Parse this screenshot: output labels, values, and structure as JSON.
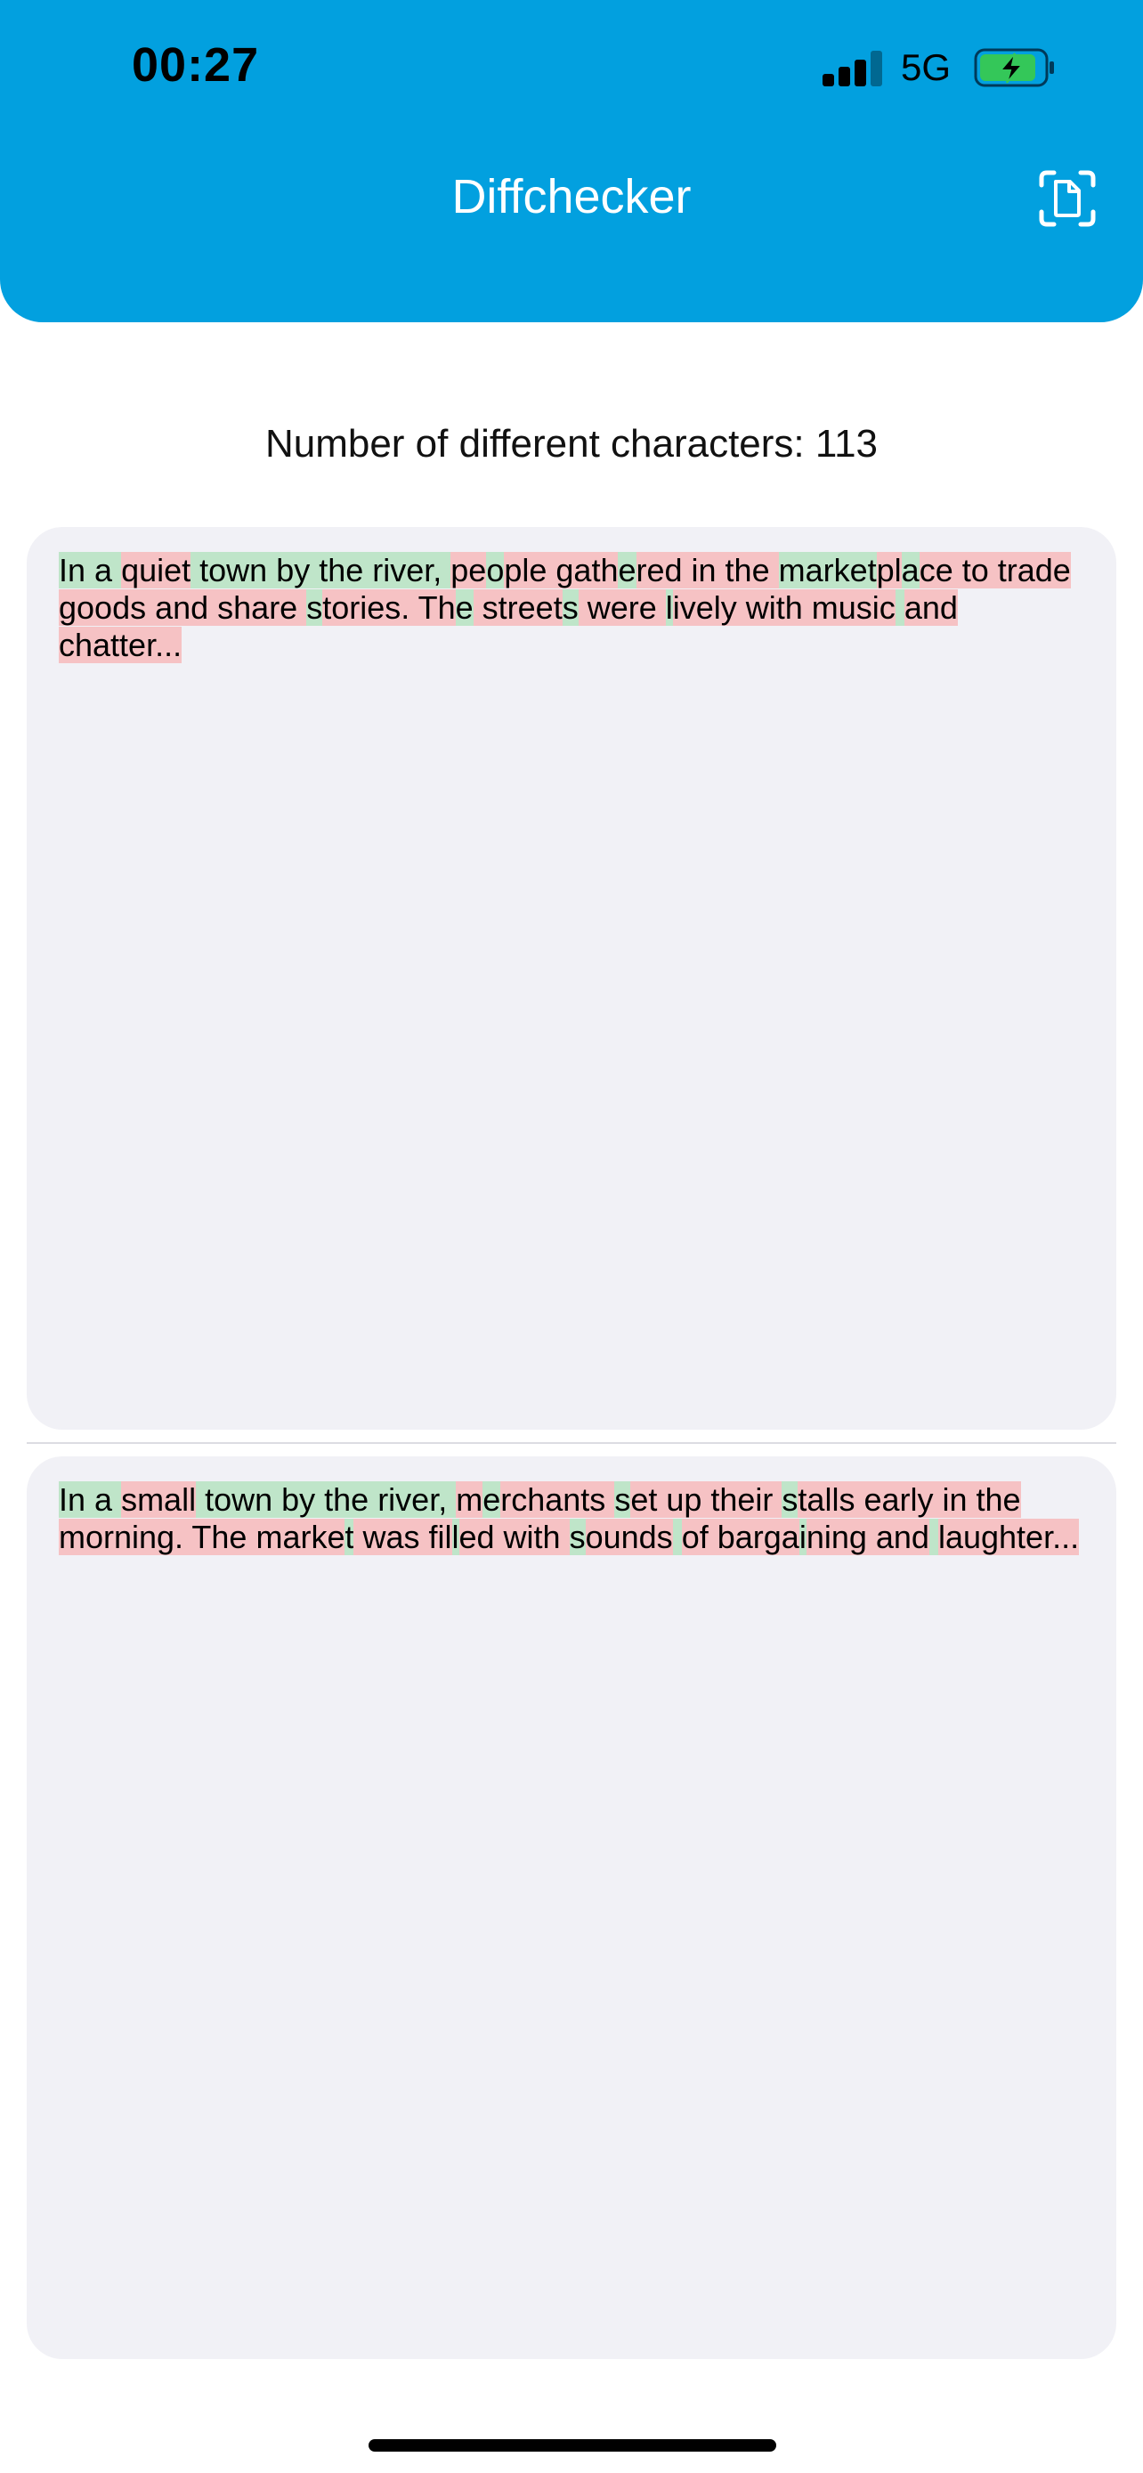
{
  "status_bar": {
    "time": "00:27",
    "network": "5G"
  },
  "header": {
    "title": "Diffchecker",
    "scan_button_icon": "document-scan-icon"
  },
  "summary": {
    "label": "Number of different characters: 113"
  },
  "colors": {
    "header_bg": "#02a0df",
    "panel_bg": "#f1f1f6",
    "same_highlight": "#bfe5c9",
    "diff_highlight": "#f6c2c4"
  },
  "text_a": {
    "full": "In a quiet town by the river, people gathered in the marketplace to trade goods and share stories. The streets were lively with music and chatter...",
    "segments": [
      {
        "t": "In a ",
        "k": "s"
      },
      {
        "t": "quiet",
        "k": "d"
      },
      {
        "t": " town by the river, ",
        "k": "s"
      },
      {
        "t": "pe",
        "k": "d"
      },
      {
        "t": "o",
        "k": "s"
      },
      {
        "t": "ple gath",
        "k": "d"
      },
      {
        "t": "e",
        "k": "s"
      },
      {
        "t": "red in the ",
        "k": "d"
      },
      {
        "t": "market",
        "k": "s"
      },
      {
        "t": "pl",
        "k": "d"
      },
      {
        "t": "a",
        "k": "s"
      },
      {
        "t": "ce to trade goods and share ",
        "k": "d"
      },
      {
        "t": "s",
        "k": "s"
      },
      {
        "t": "tories. Th",
        "k": "d"
      },
      {
        "t": "e",
        "k": "s"
      },
      {
        "t": " street",
        "k": "d"
      },
      {
        "t": "s",
        "k": "s"
      },
      {
        "t": " were ",
        "k": "d"
      },
      {
        "t": "l",
        "k": "s"
      },
      {
        "t": "ively with music",
        "k": "d"
      },
      {
        "t": " ",
        "k": "s"
      },
      {
        "t": "and ",
        "k": "d"
      },
      {
        "t": "chatter...",
        "k": "d"
      }
    ]
  },
  "text_b": {
    "full": "In a small town by the river, merchants set up their stalls early in the morning. The market was filled with sounds of bargaining and laughter...",
    "segments": [
      {
        "t": "In a ",
        "k": "s"
      },
      {
        "t": "small",
        "k": "d"
      },
      {
        "t": " town by the river, ",
        "k": "s"
      },
      {
        "t": "m",
        "k": "d"
      },
      {
        "t": "e",
        "k": "s"
      },
      {
        "t": "rchants ",
        "k": "d"
      },
      {
        "t": "s",
        "k": "s"
      },
      {
        "t": "et up their ",
        "k": "d"
      },
      {
        "t": "s",
        "k": "s"
      },
      {
        "t": "talls early in the morning. The marke",
        "k": "d"
      },
      {
        "t": "t",
        "k": "s"
      },
      {
        "t": " was fil",
        "k": "d"
      },
      {
        "t": "l",
        "k": "s"
      },
      {
        "t": "ed with ",
        "k": "d"
      },
      {
        "t": "s",
        "k": "s"
      },
      {
        "t": "ounds",
        "k": "d"
      },
      {
        "t": " ",
        "k": "s"
      },
      {
        "t": "of barga",
        "k": "d"
      },
      {
        "t": "i",
        "k": "s"
      },
      {
        "t": "ning and",
        "k": "d"
      },
      {
        "t": " ",
        "k": "s"
      },
      {
        "t": "laughter...",
        "k": "d"
      }
    ]
  }
}
